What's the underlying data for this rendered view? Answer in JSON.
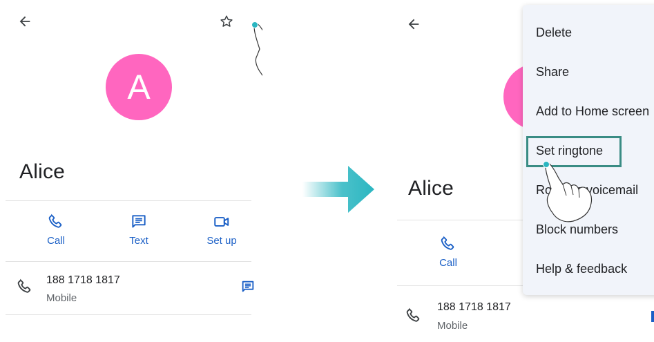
{
  "left": {
    "contact_initial": "A",
    "contact_name": "Alice",
    "actions": [
      {
        "label": "Call",
        "icon": "phone-icon"
      },
      {
        "label": "Text",
        "icon": "message-icon"
      },
      {
        "label": "Set up",
        "icon": "video-icon"
      }
    ],
    "phone_number": "188 1718 1817",
    "phone_type": "Mobile"
  },
  "right": {
    "contact_name": "Alice",
    "actions": [
      {
        "label": "Call",
        "icon": "phone-icon"
      }
    ],
    "phone_number": "188 1718 1817",
    "phone_type": "Mobile",
    "menu": {
      "items": [
        "Delete",
        "Share",
        "Add to Home screen",
        "Set ringtone",
        "Route to voicemail",
        "Block numbers",
        "Help & feedback"
      ],
      "highlighted": "Set ringtone"
    }
  },
  "colors": {
    "avatar": "#ff66bf",
    "accent_blue": "#1a5fc6",
    "arrow": "#2bb6c1",
    "highlight": "#3a8c84",
    "menu_bg": "#f1f4fa"
  }
}
